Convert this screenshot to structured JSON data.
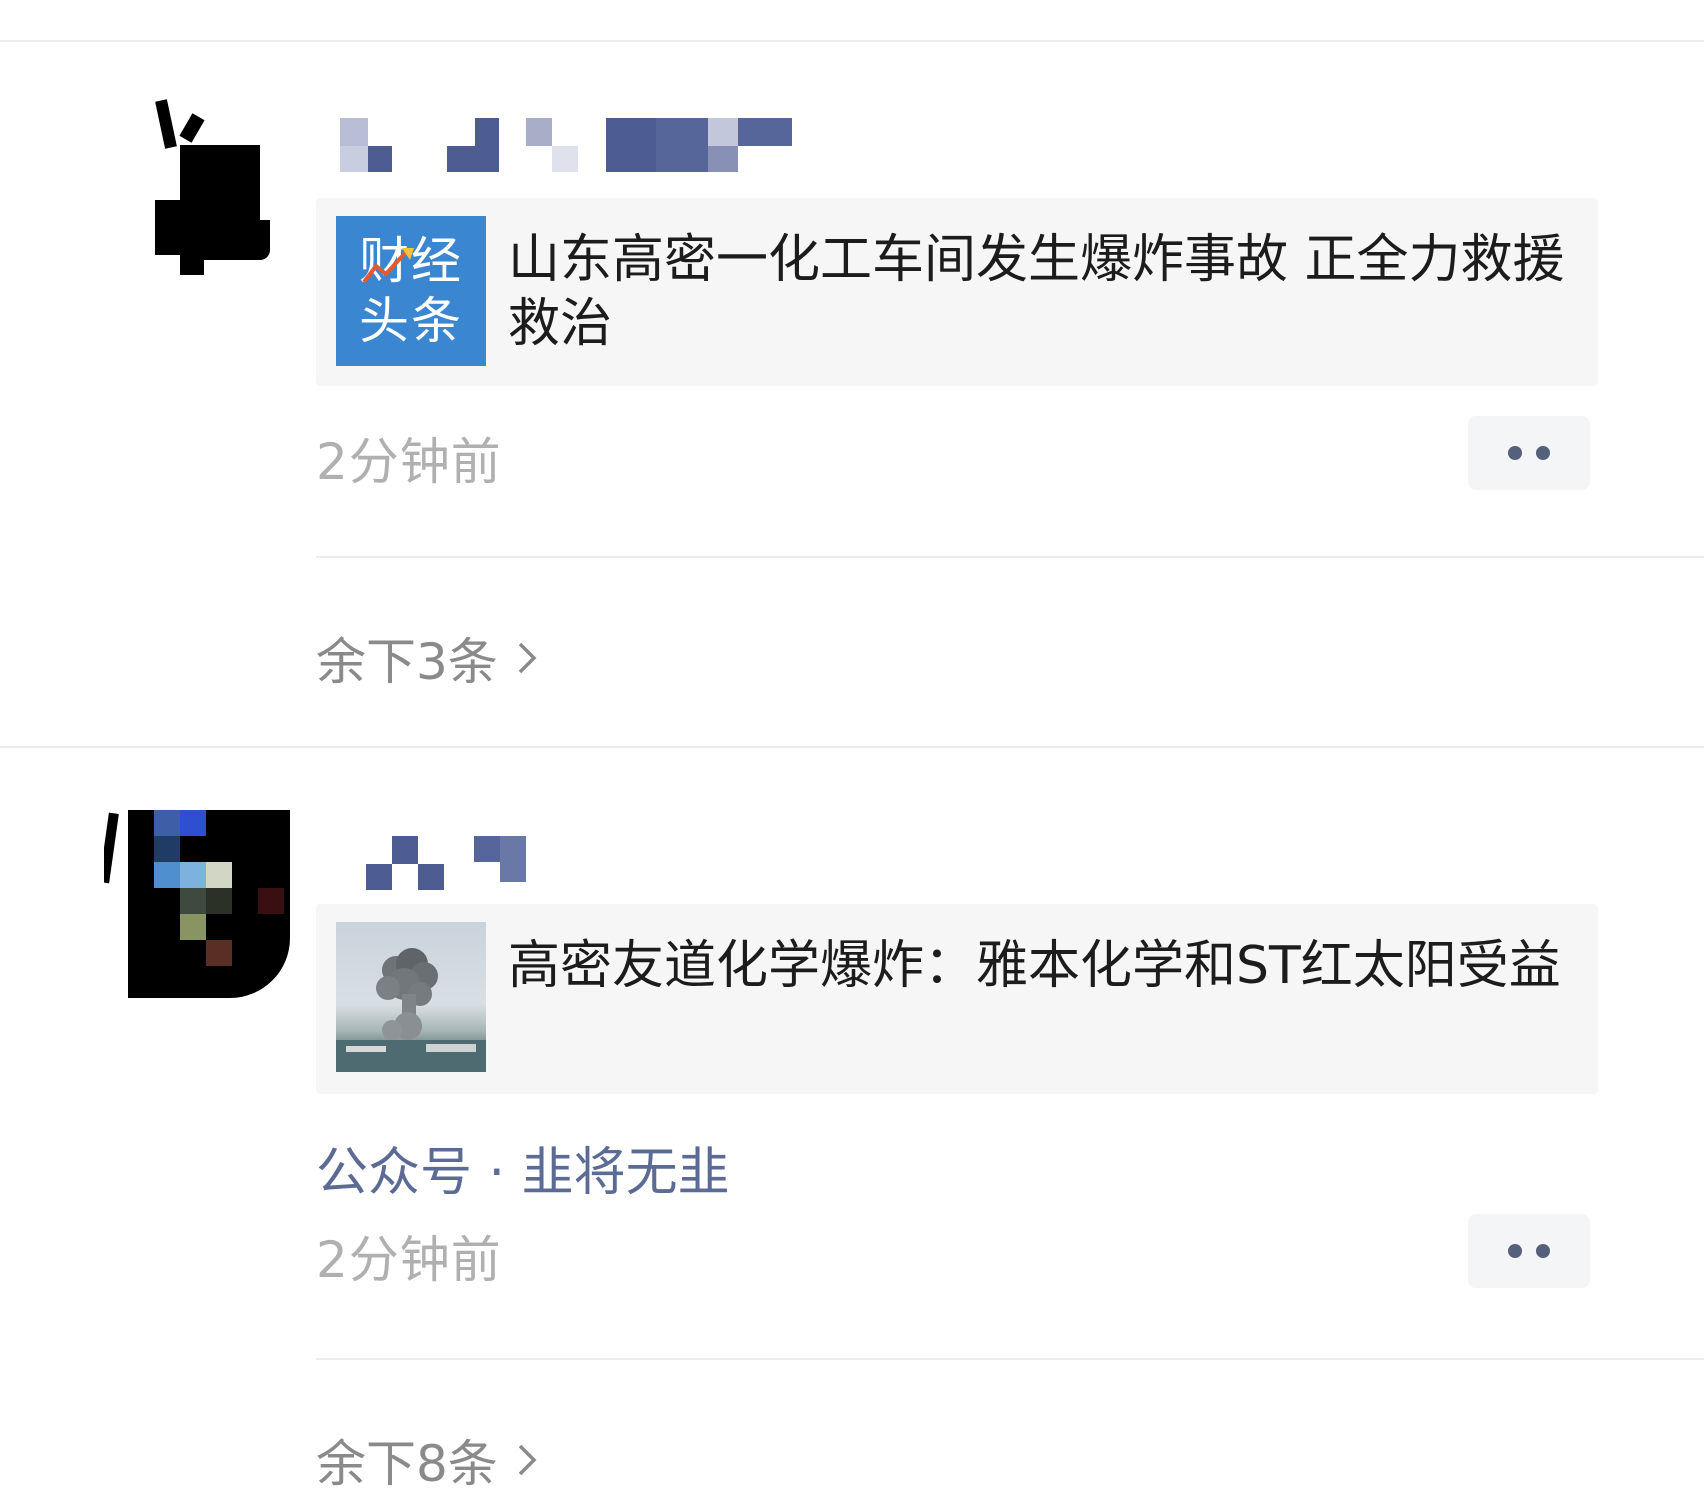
{
  "feed": {
    "posts": [
      {
        "card": {
          "thumb_logo_line1": "财经",
          "thumb_logo_line2": "头条",
          "title": "山东高密一化工车间发生爆炸事故 正全力救援救治"
        },
        "time": "2分钟前",
        "remaining": "余下3条"
      },
      {
        "card": {
          "title": "高密友道化学爆炸：雅本化学和ST红太阳受益"
        },
        "source": "公众号 · 韭将无韭",
        "time": "2分钟前",
        "remaining": "余下8条"
      }
    ]
  },
  "colors": {
    "logo_bg": "#3a86d1",
    "source_link": "#5b6b94",
    "time_text": "#b0b0b0",
    "pixelated_name": "#4a5a8c"
  },
  "icons": {
    "more": "more-dots-icon",
    "chevron": "chevron-right-icon"
  }
}
